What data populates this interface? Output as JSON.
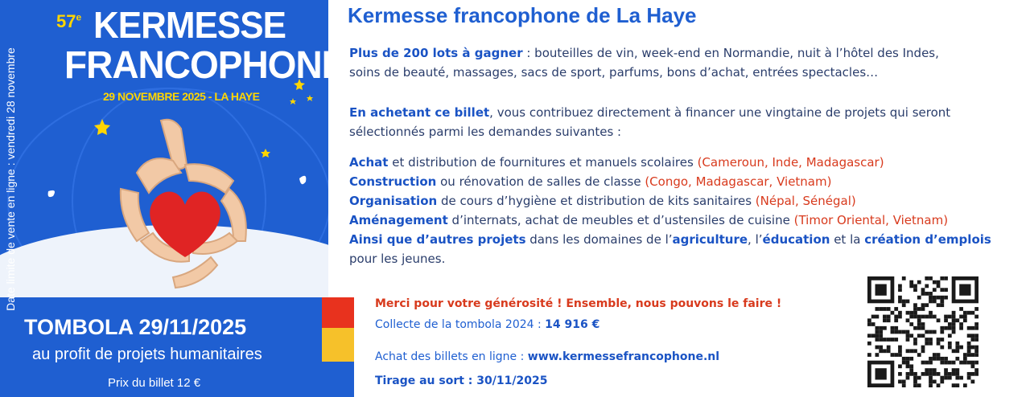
{
  "poster": {
    "edition_number": "57",
    "edition_suffix": "e",
    "title_line1": "KERMESSE",
    "title_line2": "FRANCOPHONE",
    "date_place": "29 NOVEMBRE 2025 - LA HAYE",
    "vertical_note": "Date limite de vente en ligne : vendredi 28 novembre"
  },
  "band": {
    "tombola": "TOMBOLA  29/11/2025",
    "subtitle": "au profit de projets humanitaires",
    "price": "Prix du billet 12 €"
  },
  "colors": {
    "blue": "#1f5fd1",
    "red": "#e8321e",
    "yellow": "#f6c12a",
    "heart": "#e02424",
    "text_dark": "#2a3d6b"
  },
  "content": {
    "title": "Kermesse francophone de La Haye",
    "p1_bold": "Plus de 200 lots à gagner",
    "p1_rest": " : bouteilles de vin, week-end en Normandie, nuit à l’hôtel des Indes,",
    "p1_line2": "soins de beauté, massages, sacs de sport, parfums, bons d’achat, entrées spectacles…",
    "p2_bold": "En achetant ce billet",
    "p2_rest": ", vous contribuez directement à financer une vingtaine de projets qui seront",
    "p2_line2": "sélectionnés parmi les demandes suivantes :",
    "items": [
      {
        "bold": "Achat",
        "text": " et distribution de fournitures et manuels scolaires ",
        "countries": "(Cameroun, Inde, Madagascar)"
      },
      {
        "bold": "Construction",
        "text": " ou rénovation de salles de classe ",
        "countries": "(Congo, Madagascar, Vietnam)"
      },
      {
        "bold": "Organisation",
        "text": " de cours d’hygiène et distribution de kits sanitaires ",
        "countries": "(Népal, Sénégal)"
      },
      {
        "bold": "Aménagement",
        "text": " d’internats, achat de meubles et d’ustensiles de cuisine ",
        "countries": "(Timor Oriental, Vietnam)"
      }
    ],
    "other": {
      "bold1": "Ainsi que d’autres projets",
      "t1": " dans les domaines de l’",
      "bold2": "agriculture",
      "t2": ", l’",
      "bold3": "éducation",
      "t3": " et la ",
      "bold4": "création d’emplois",
      "line2": "pour les jeunes."
    }
  },
  "footer": {
    "merci": "Merci pour votre générosité ! Ensemble, nous pouvons le faire !",
    "collecte_label": "Collecte de la tombola 2024 : ",
    "collecte_value": "14 916 €",
    "achat_label": "Achat des billets en ligne : ",
    "achat_url": "www.kermessefrancophone.nl",
    "tirage": "Tirage au sort : 30/11/2025"
  }
}
